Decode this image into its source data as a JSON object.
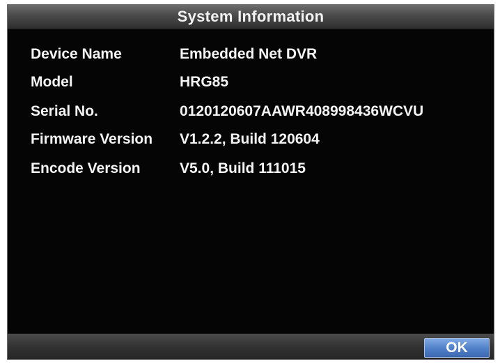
{
  "dialog": {
    "title": "System Information"
  },
  "info": [
    {
      "label": "Device Name",
      "value": "Embedded Net DVR"
    },
    {
      "label": "Model",
      "value": "HRG85"
    },
    {
      "label": "Serial No.",
      "value": "0120120607AAWR408998436WCVU"
    },
    {
      "label": "Firmware Version",
      "value": "V1.2.2, Build 120604"
    },
    {
      "label": "Encode Version",
      "value": "V5.0, Build 111015"
    }
  ],
  "footer": {
    "ok_label": "OK"
  }
}
